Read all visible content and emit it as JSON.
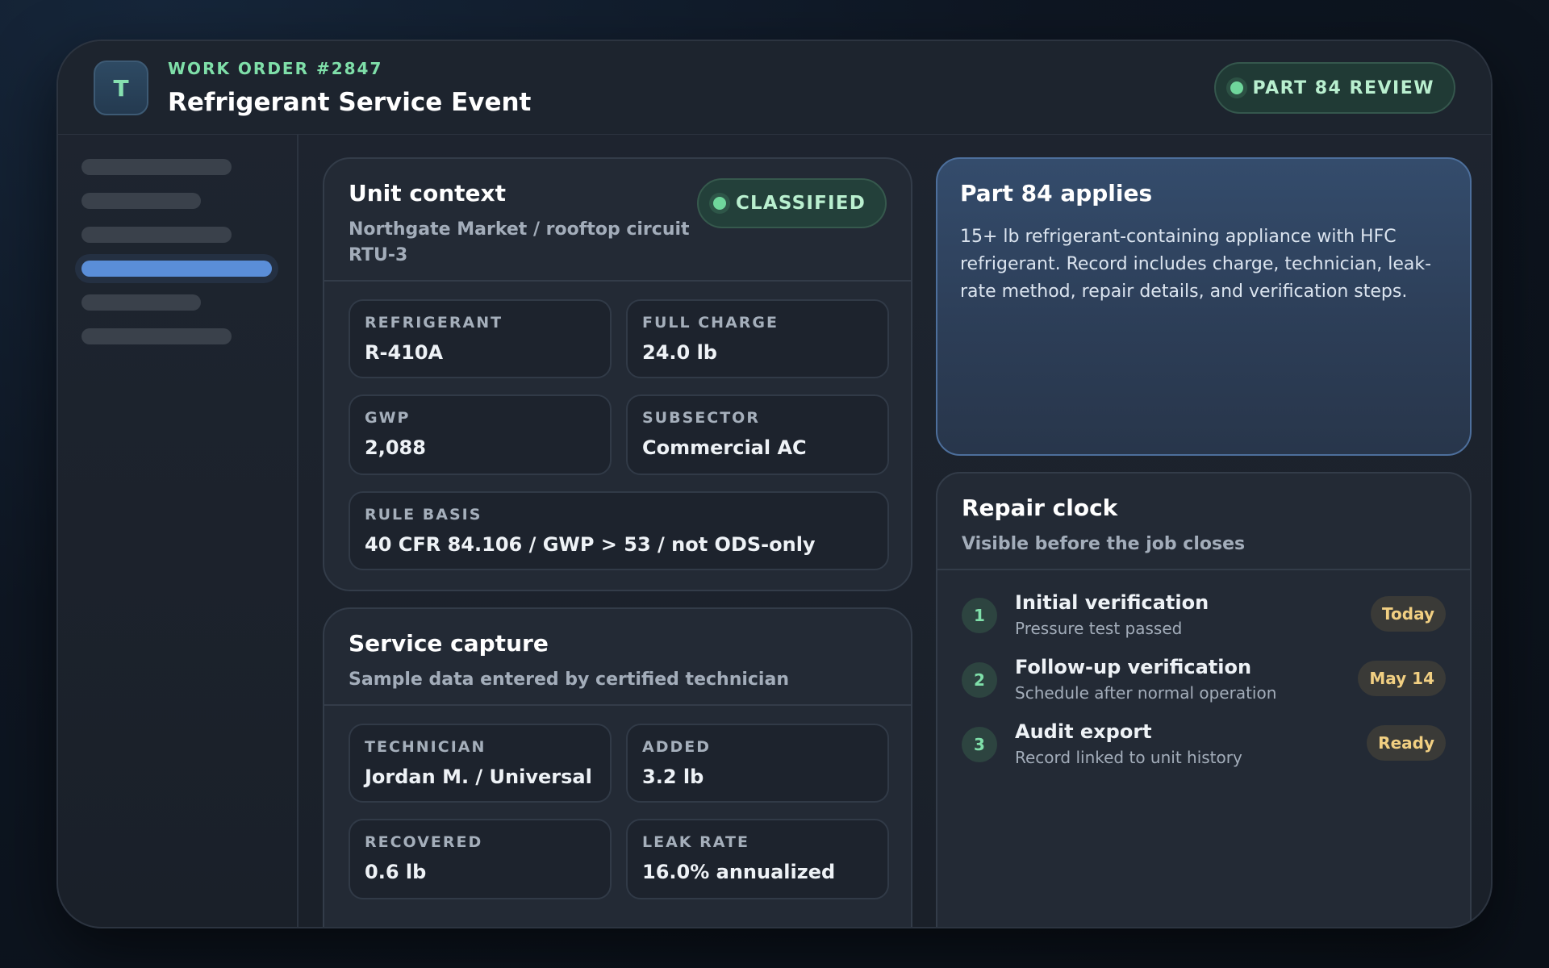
{
  "header": {
    "avatar_initial": "T",
    "work_order": "WORK ORDER #2847",
    "title": "Refrigerant Service Event",
    "review_badge": "PART 84 REVIEW"
  },
  "sidebar": {
    "active_index": 3,
    "item_count": 6
  },
  "unit_context": {
    "title": "Unit context",
    "subtitle_line1": "Northgate Market / rooftop circuit",
    "subtitle_line2": "RTU-3",
    "status": "CLASSIFIED",
    "fields": [
      {
        "label": "REFRIGERANT",
        "value": "R-410A"
      },
      {
        "label": "FULL CHARGE",
        "value": "24.0 lb"
      },
      {
        "label": "GWP",
        "value": "2,088"
      },
      {
        "label": "SUBSECTOR",
        "value": "Commercial AC"
      },
      {
        "label": "RULE BASIS",
        "value": "40 CFR 84.106 / GWP > 53 / not ODS-only"
      }
    ]
  },
  "service_capture": {
    "title": "Service capture",
    "subtitle": "Sample data entered by certified technician",
    "fields": [
      {
        "label": "TECHNICIAN",
        "value": "Jordan M. / Universal"
      },
      {
        "label": "ADDED",
        "value": "3.2 lb"
      },
      {
        "label": "RECOVERED",
        "value": "0.6 lb"
      },
      {
        "label": "LEAK RATE",
        "value": "16.0% annualized"
      }
    ]
  },
  "applies": {
    "title": "Part 84 applies",
    "text": "15+ lb refrigerant-containing appliance with HFC refrigerant. Record includes charge, technician, leak-rate method, repair details, and verification steps."
  },
  "repair_clock": {
    "title": "Repair clock",
    "subtitle": "Visible before the job closes",
    "steps": [
      {
        "num": "1",
        "title": "Initial verification",
        "desc": "Pressure test passed",
        "status": "Today"
      },
      {
        "num": "2",
        "title": "Follow-up verification",
        "desc": "Schedule after normal operation",
        "status": "May 14"
      },
      {
        "num": "3",
        "title": "Audit export",
        "desc": "Record linked to unit history",
        "status": "Ready"
      }
    ]
  },
  "colors": {
    "accent_green": "#7fdfa9",
    "accent_blue": "#5a8ed8",
    "pill_amber": "#f1cf82"
  }
}
